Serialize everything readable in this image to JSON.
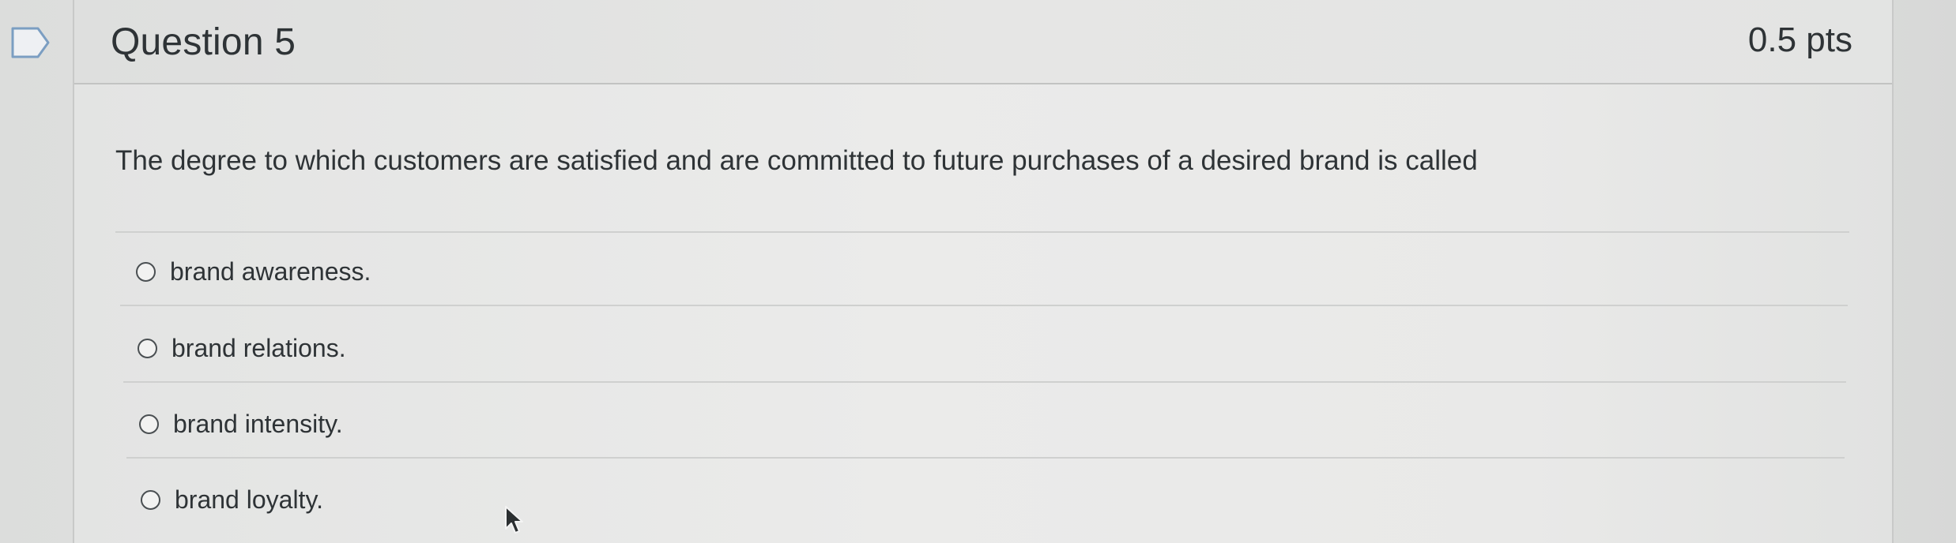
{
  "question": {
    "title": "Question 5",
    "points": "0.5 pts",
    "text": "The degree to which customers are satisfied and are committed to future purchases of a desired brand is called",
    "flag_icon": "flag-icon"
  },
  "answers": [
    {
      "label": "brand awareness."
    },
    {
      "label": "brand relations."
    },
    {
      "label": "brand intensity."
    },
    {
      "label": "brand loyalty."
    }
  ],
  "colors": {
    "text": "#2e3336",
    "divider": "#cfd0cf",
    "background": "#e6e7e6"
  }
}
